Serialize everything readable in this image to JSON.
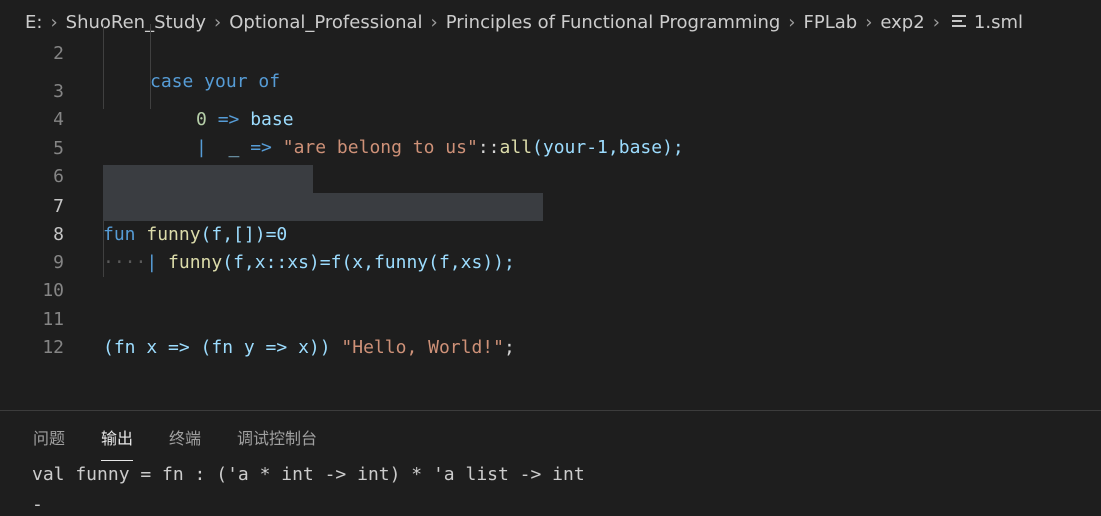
{
  "breadcrumb": {
    "items": [
      "E:",
      "ShuoRen_Study",
      "Optional_Professional",
      "Principles of Functional Programming",
      "FPLab",
      "exp2"
    ],
    "file": "1.sml"
  },
  "editor": {
    "line_numbers": [
      "2",
      "3",
      "4",
      "5",
      "6",
      "7",
      "8",
      "9",
      "10",
      "11",
      "12"
    ],
    "line2_partial": "case your of",
    "line3": {
      "a": "0",
      "b": "=>",
      "c": "base"
    },
    "line4": {
      "bar": "|",
      "u": "_",
      "arrow": "=>",
      "s": "\"are belong to us\"",
      "cons": "::",
      "all": "all",
      "rest": "(your-1,base);"
    },
    "line7": {
      "kw": "fun",
      "name": "funny",
      "args": "(f,[])=0"
    },
    "line8": {
      "dots": "····",
      "bar": "|",
      "name": "funny",
      "args": "(f,x::xs)=f(x,funny(f,xs));"
    },
    "line11": {
      "a": "(fn x => (fn y => x))",
      "s": "\"Hello, World!\"",
      "end": ";"
    }
  },
  "panel": {
    "tabs": [
      "问题",
      "输出",
      "终端",
      "调试控制台"
    ],
    "active_tab": "输出",
    "output_lines": [
      "val funny = fn : ('a * int -> int) * 'a list -> int",
      "-"
    ]
  }
}
